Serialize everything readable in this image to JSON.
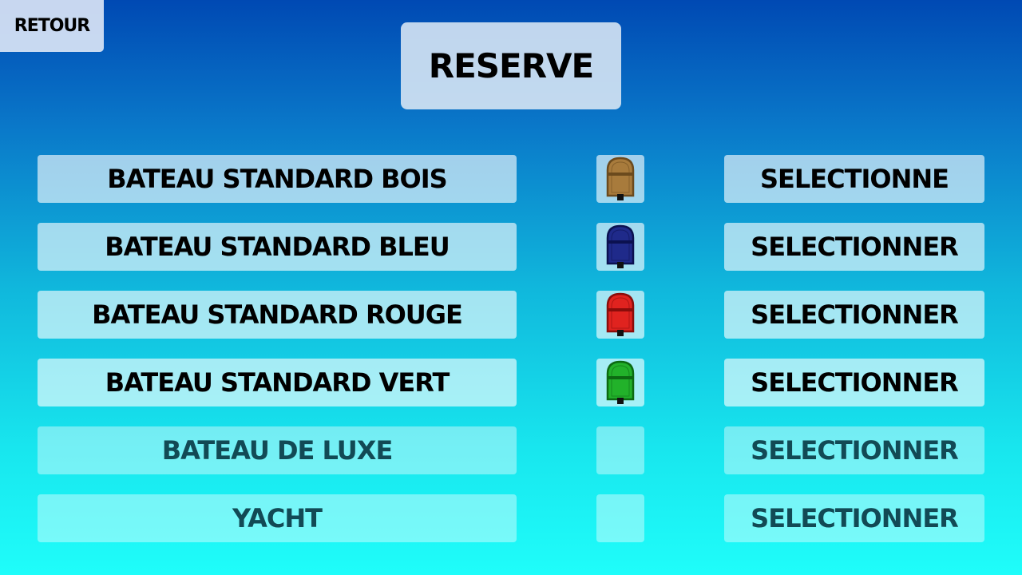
{
  "header": {
    "back_label": "RETOUR",
    "title": "RESERVE"
  },
  "boats": [
    {
      "name": "BATEAU STANDARD BOIS",
      "action": "SELECTIONNE",
      "icon": "wooden-boat-icon",
      "color": "#a87b3c",
      "dark": "#6b4a1d",
      "enabled": true
    },
    {
      "name": "BATEAU STANDARD BLEU",
      "action": "SELECTIONNER",
      "icon": "blue-boat-icon",
      "color": "#1f2a8a",
      "dark": "#0b1150",
      "enabled": true
    },
    {
      "name": "BATEAU STANDARD ROUGE",
      "action": "SELECTIONNER",
      "icon": "red-boat-icon",
      "color": "#e0231f",
      "dark": "#8a0d0b",
      "enabled": true
    },
    {
      "name": "BATEAU STANDARD VERT",
      "action": "SELECTIONNER",
      "icon": "green-boat-icon",
      "color": "#22b22a",
      "dark": "#0c6a12",
      "enabled": true
    },
    {
      "name": "BATEAU DE LUXE",
      "action": "SELECTIONNER",
      "icon": "",
      "color": "",
      "dark": "",
      "enabled": false
    },
    {
      "name": "YACHT",
      "action": "SELECTIONNER",
      "icon": "",
      "color": "",
      "dark": "",
      "enabled": false
    }
  ]
}
